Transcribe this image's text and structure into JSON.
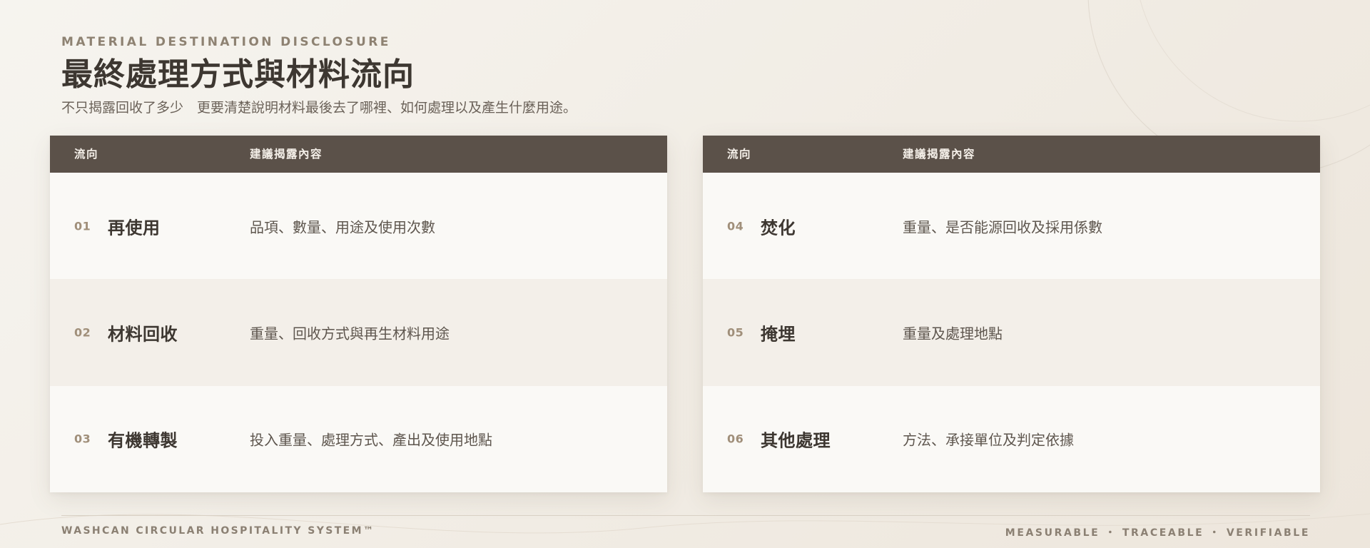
{
  "header": {
    "eyebrow": "MATERIAL DESTINATION DISCLOSURE",
    "title": "最終處理方式與材料流向",
    "subtitle": "不只揭露回收了多少　更要清楚說明材料最後去了哪裡、如何處理以及產生什麼用途。"
  },
  "tables": [
    {
      "columns": {
        "destination": "流向",
        "content": "建議揭露內容"
      },
      "rows": [
        {
          "num": "01",
          "name": "再使用",
          "desc": "品項、數量、用途及使用次數"
        },
        {
          "num": "02",
          "name": "材料回收",
          "desc": "重量、回收方式與再生材料用途"
        },
        {
          "num": "03",
          "name": "有機轉製",
          "desc": "投入重量、處理方式、產出及使用地點"
        }
      ]
    },
    {
      "columns": {
        "destination": "流向",
        "content": "建議揭露內容"
      },
      "rows": [
        {
          "num": "04",
          "name": "焚化",
          "desc": "重量、是否能源回收及採用係數"
        },
        {
          "num": "05",
          "name": "掩埋",
          "desc": "重量及處理地點"
        },
        {
          "num": "06",
          "name": "其他處理",
          "desc": "方法、承接單位及判定依據"
        }
      ]
    }
  ],
  "footer": {
    "left": "WASHCAN CIRCULAR HOSPITALITY SYSTEM™",
    "right": "MEASURABLE ・ TRACEABLE ・ VERIFIABLE"
  },
  "colors": {
    "header_bar": "#5b5149",
    "accent_number": "#a08f7a",
    "title_text": "#3d3731"
  }
}
